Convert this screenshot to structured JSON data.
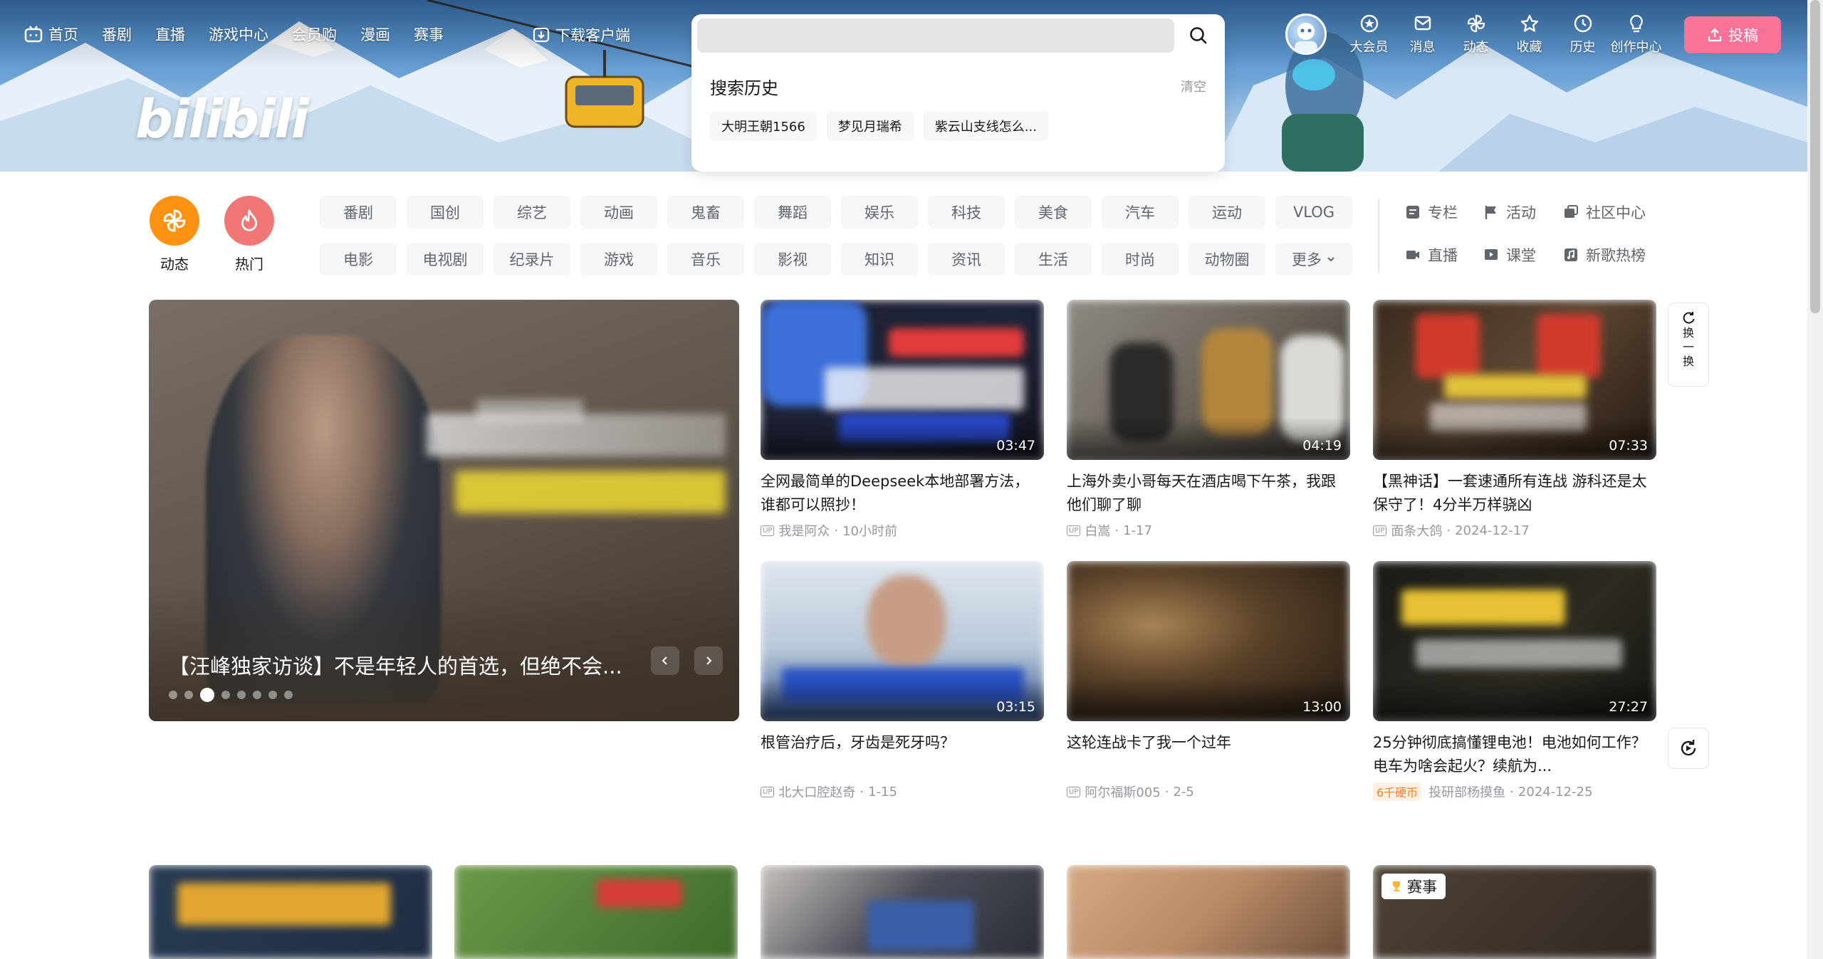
{
  "nav_left": {
    "items": [
      {
        "label": "首页",
        "icon": "tv-icon"
      },
      {
        "label": "番剧"
      },
      {
        "label": "直播"
      },
      {
        "label": "游戏中心"
      },
      {
        "label": "会员购"
      },
      {
        "label": "漫画"
      },
      {
        "label": "赛事"
      }
    ],
    "download": "下载客户端"
  },
  "logo": "bilibili",
  "search": {
    "value": "",
    "placeholder": "",
    "history_title": "搜索历史",
    "clear_label": "清空",
    "history": [
      "大明王朝1566",
      "梦见月瑞希",
      "紫云山支线怎么..."
    ]
  },
  "nav_right": {
    "items": [
      {
        "label": "大会员",
        "icon": "vip-icon"
      },
      {
        "label": "消息",
        "icon": "message-icon"
      },
      {
        "label": "动态",
        "icon": "pinwheel-icon"
      },
      {
        "label": "收藏",
        "icon": "star-icon"
      },
      {
        "label": "历史",
        "icon": "clock-icon"
      },
      {
        "label": "创作中心",
        "icon": "bulb-icon"
      }
    ],
    "upload": "投稿"
  },
  "quick": [
    {
      "label": "动态",
      "icon": "pinwheel-icon",
      "color": "#ff9212"
    },
    {
      "label": "热门",
      "icon": "fire-icon",
      "color": "#f07775"
    }
  ],
  "channels": [
    "番剧",
    "国创",
    "综艺",
    "动画",
    "鬼畜",
    "舞蹈",
    "娱乐",
    "科技",
    "美食",
    "汽车",
    "运动",
    "VLOG",
    "电影",
    "电视剧",
    "纪录片",
    "游戏",
    "音乐",
    "影视",
    "知识",
    "资讯",
    "生活",
    "时尚",
    "动物圈",
    "更多"
  ],
  "side_links": [
    {
      "label": "专栏",
      "icon": "column-icon"
    },
    {
      "label": "活动",
      "icon": "flag-icon"
    },
    {
      "label": "社区中心",
      "icon": "community-icon"
    },
    {
      "label": "直播",
      "icon": "live-icon"
    },
    {
      "label": "课堂",
      "icon": "class-icon"
    },
    {
      "label": "新歌热榜",
      "icon": "music-icon"
    }
  ],
  "carousel": {
    "title": "【汪峰独家访谈】不是年轻人的首选，但绝不会...",
    "slides": 8,
    "active": 2
  },
  "videos": [
    {
      "duration": "03:47",
      "title": "全网最简单的Deepseek本地部署方法，谁都可以照抄！",
      "author": "我是阿众",
      "date": "10小时前"
    },
    {
      "duration": "04:19",
      "title": "上海外卖小哥每天在酒店喝下午茶，我跟他们聊了聊",
      "author": "白嵩",
      "date": "1-17"
    },
    {
      "duration": "07:33",
      "title": "【黑神话】一套速通所有连战 游科还是太保守了！4分半万样骁凶",
      "author": "面条大鸽",
      "date": "2024-12-17"
    },
    {
      "duration": "03:15",
      "title": "根管治疗后，牙齿是死牙吗？",
      "author": "北大口腔赵奇",
      "date": "1-15"
    },
    {
      "duration": "13:00",
      "title": "这轮连战卡了我一个过年",
      "author": "阿尔福斯005",
      "date": "2-5"
    },
    {
      "duration": "27:27",
      "title": "25分钟彻底搞懂锂电池！电池如何工作？电车为啥会起火？续航为...",
      "author": "投研部杨摸鱼",
      "date": "2024-12-25",
      "coin": "6千硬币"
    }
  ],
  "refresh": [
    "换",
    "一",
    "换"
  ],
  "event_badge": "赛事",
  "colors": {
    "accent": "#fb7299",
    "coin": "#ff7f24"
  }
}
